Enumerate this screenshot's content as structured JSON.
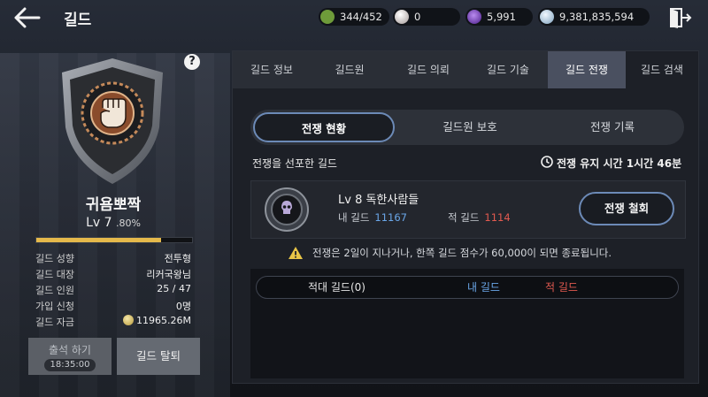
{
  "header": {
    "title": "길드",
    "back_icon": "back-arrow-icon",
    "exit_icon": "exit-door-icon",
    "resources": [
      {
        "icon": "energy-icon",
        "value": "344/452",
        "color": "#8bbf4a"
      },
      {
        "icon": "pearl-icon",
        "value": "0",
        "color": "#d9d2cf"
      },
      {
        "icon": "black-stone-icon",
        "value": "5,991",
        "color": "#7b3cc9"
      },
      {
        "icon": "silver-coin-icon",
        "value": "9,381,835,594",
        "color": "#bcd6ea"
      }
    ]
  },
  "guild": {
    "name": "귀욤뽀짝",
    "level_label": "Lv 7",
    "level_percent": ".80%",
    "xp_fraction": 0.8,
    "emblem_icon": "fist-emblem-icon",
    "help_label": "?",
    "info": [
      {
        "key": "길드 성향",
        "value": "전투형"
      },
      {
        "key": "길드 대장",
        "value": "리커국왕님"
      },
      {
        "key": "길드 인원",
        "value": "25 / 47"
      },
      {
        "key": "가입 신청",
        "value": "0명"
      },
      {
        "key": "길드 자금",
        "value": "11965.26M"
      }
    ],
    "attend_label": "출석 하기",
    "attend_time": "18:35:00",
    "leave_label": "길드 탈퇴"
  },
  "tabs": [
    "길드 정보",
    "길드원",
    "길드 의뢰",
    "길드 기술",
    "길드 전쟁",
    "길드 검색"
  ],
  "active_tab_index": 4,
  "war": {
    "segments": [
      "전쟁 현황",
      "길드원 보호",
      "전쟁 기록"
    ],
    "active_segment_index": 0,
    "declared_label": "전쟁을 선포한 길드",
    "maintain_time": "전쟁 유지 시간 1시간 46분",
    "opponent": {
      "name": "Lv 8 독한사람들",
      "my_label": "내 길드",
      "my_score": "11167",
      "enemy_label": "적 길드",
      "enemy_score": "1114"
    },
    "withdraw_label": "전쟁 철회",
    "notice": "전쟁은 2일이 지나거나, 한쪽 길드 점수가 60,000이 되면 종료됩니다.",
    "list_headers": [
      "적대 길드(0)",
      "내 길드",
      "적 길드"
    ]
  },
  "colors": {
    "accent_border": "#6c8ab7",
    "my_guild": "#6aa6e8",
    "enemy_guild": "#e25a50",
    "xp_fill": "#e5b94b"
  }
}
